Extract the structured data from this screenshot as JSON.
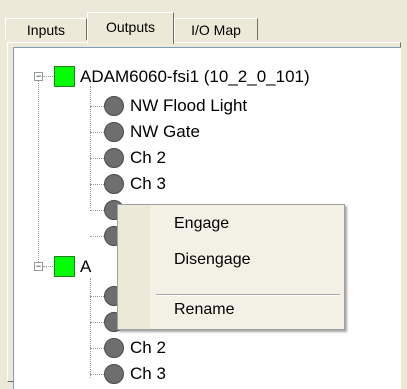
{
  "tabs": [
    {
      "label": "Inputs"
    },
    {
      "label": "Outputs",
      "selected": true
    },
    {
      "label": "I/O Map"
    }
  ],
  "tree": {
    "groups": [
      {
        "label": "ADAM6060-fsi1 (10_2_0_101)",
        "status_color": "#00ff00",
        "expander": "−",
        "channels": [
          "NW Flood Light",
          "NW Gate",
          "Ch 2",
          "Ch 3",
          "",
          ""
        ]
      },
      {
        "label_visible_start": "A",
        "label_visible_end": ")",
        "status_color": "#00ff00",
        "expander": "−",
        "channels": [
          "",
          "",
          "Ch 2",
          "Ch 3"
        ]
      }
    ]
  },
  "context_menu": {
    "items": [
      "Engage",
      "Disengage",
      "Rename"
    ]
  }
}
